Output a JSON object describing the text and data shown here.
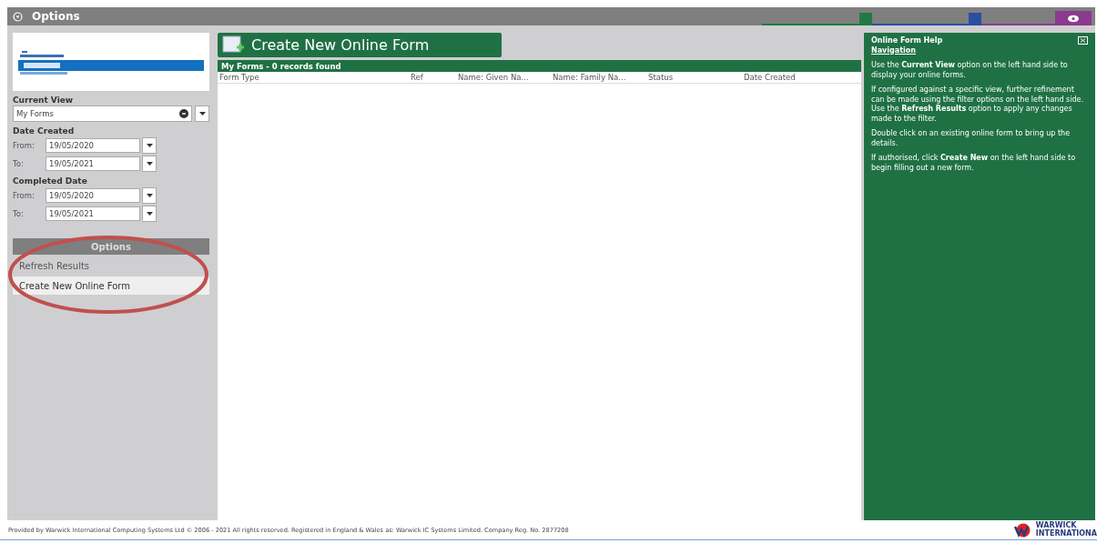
{
  "title_bar": {
    "title": "Options",
    "tabs": [
      {
        "color": "#1f7a45",
        "selected": false
      },
      {
        "color": "#2a4f9e",
        "selected": false
      },
      {
        "color": "#8b3a8f",
        "selected": true
      }
    ]
  },
  "sidebar": {
    "current_view": {
      "label": "Current View",
      "value": "My Forms"
    },
    "filters": [
      {
        "title": "Date Created",
        "fields": [
          {
            "label": "From:",
            "value": "19/05/2020"
          },
          {
            "label": "To:",
            "value": "19/05/2021"
          }
        ]
      },
      {
        "title": "Completed Date",
        "fields": [
          {
            "label": "From:",
            "value": "19/05/2020"
          },
          {
            "label": "To:",
            "value": "19/05/2021"
          }
        ]
      }
    ],
    "options_header": "Options",
    "actions": [
      {
        "label": "Refresh Results",
        "selected": false
      },
      {
        "label": "Create New Online Form",
        "selected": true
      }
    ],
    "annotation": {
      "kind": "ellipse",
      "color": "#c0504d"
    }
  },
  "main": {
    "create_button": "Create New Online Form",
    "list_title": "My Forms - 0 records found",
    "columns": [
      "Form Type",
      "Ref",
      "Name: Given Na...",
      "Name: Family Na...",
      "Status",
      "Date Created"
    ]
  },
  "help": {
    "title": "Online Form Help",
    "subtitle": "Navigation",
    "paragraphs": [
      "Use the **Current View** option on the left hand side to display your online forms.",
      "If configured against a specific view, further refinement can be made using the filter options on the left hand side. Use the **Refresh Results** option to apply any changes made to the filter.",
      "Double click on an existing online form to bring up the details.",
      "If authorised, click **Create New** on the left hand side to begin filling out a new form."
    ]
  },
  "footer": {
    "text": "Provided by Warwick International Computing Systems Ltd © 2006 - 2021 All rights reserved. Registered in England & Wales as: Warwick IC Systems Limited. Company Reg. No. 2877208",
    "logo_lines": [
      "WARWICK",
      "INTERNATIONA"
    ]
  }
}
